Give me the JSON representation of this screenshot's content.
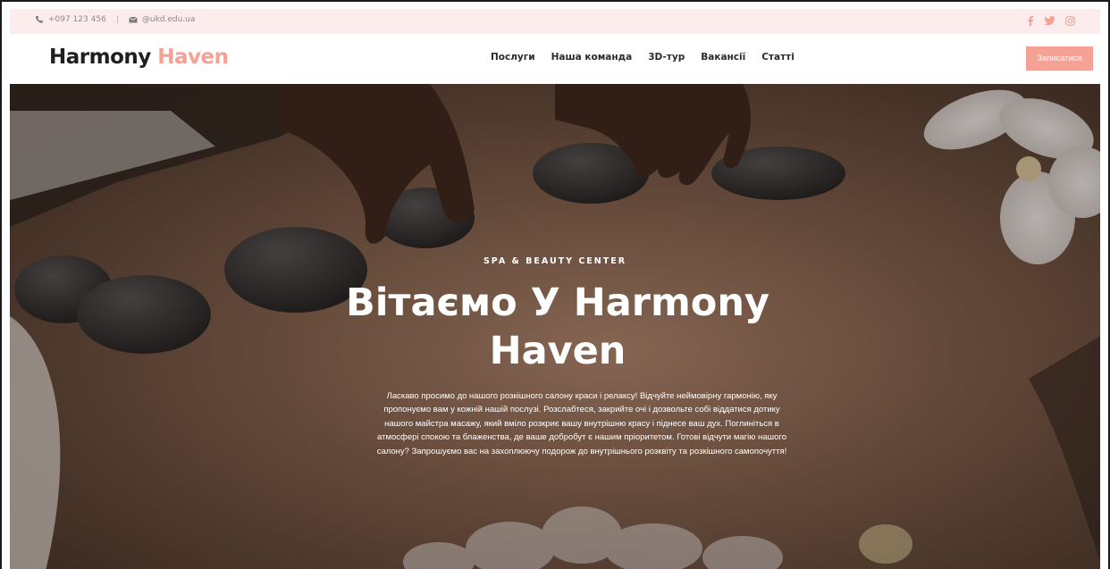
{
  "topbar": {
    "phone": "+097 123 456",
    "separator": "|",
    "email": "@ukd.edu.ua",
    "social_icons": [
      "facebook-icon",
      "twitter-icon",
      "instagram-icon"
    ]
  },
  "header": {
    "logo_part1": "Harmony",
    "logo_part2": "Haven",
    "nav": [
      "Послуги",
      "Наша команда",
      "3D-тур",
      "Вакансії",
      "Статті"
    ],
    "cta_label": "Записатися"
  },
  "hero": {
    "kicker": "SPA & BEAUTY CENTER",
    "title": "Вітаємо У Harmony Haven",
    "description": "Ласкаво просимо до нашого розкішного салону краси і релаксу! Відчуйте неймовірну гармонію, яку пропонуємо вам у кожній нашій послузі. Розслабтеся, закрийте очі і дозвольте собі віддатися дотику нашого майстра масажу, який вміло розкриє вашу внутрішню красу і піднесе ваш дух. Поглиніться в атмосфері спокою та блаженства, де ваше добробут є нашим пріоритетом. Готові відчути магію нашого салону? Запрошуємо вас на захоплюючу подорож до внутрішнього розквіту та розкішного самопочуття!"
  },
  "colors": {
    "accent": "#f5a195",
    "topbar_bg": "#fdecec",
    "text_dark": "#1f1f1f"
  }
}
